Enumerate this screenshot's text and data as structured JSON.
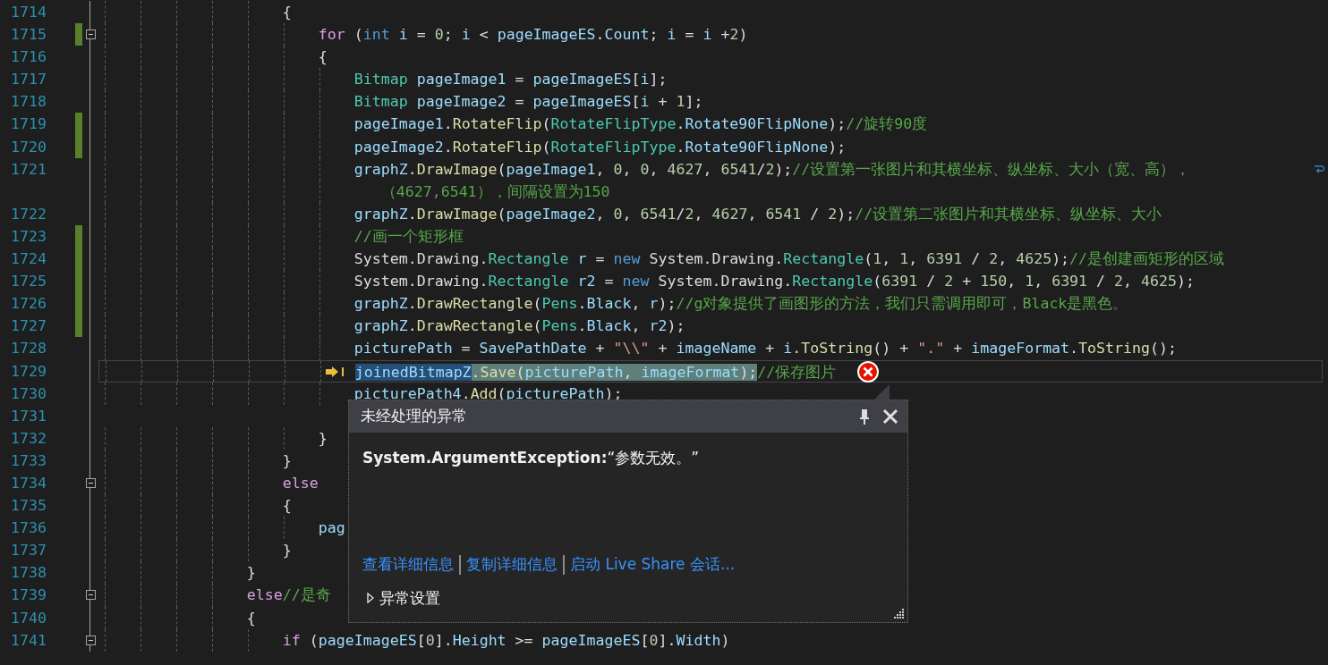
{
  "editor": {
    "lines": [
      {
        "number": "1714",
        "changed": false,
        "foldable": false,
        "tokens": [
          {
            "kind": "plain",
            "text": "                    {"
          }
        ]
      },
      {
        "number": "1715",
        "changed": true,
        "foldable": true,
        "tokens": [
          {
            "kind": "control",
            "text": "                        for"
          },
          {
            "kind": "plain",
            "text": " ("
          },
          {
            "kind": "keyword",
            "text": "int"
          },
          {
            "kind": "ident",
            "text": " i"
          },
          {
            "kind": "plain",
            "text": " = "
          },
          {
            "kind": "number",
            "text": "0"
          },
          {
            "kind": "plain",
            "text": "; "
          },
          {
            "kind": "ident",
            "text": "i"
          },
          {
            "kind": "plain",
            "text": " < "
          },
          {
            "kind": "ident",
            "text": "pageImageES"
          },
          {
            "kind": "plain",
            "text": "."
          },
          {
            "kind": "ident",
            "text": "Count"
          },
          {
            "kind": "plain",
            "text": "; "
          },
          {
            "kind": "ident",
            "text": "i"
          },
          {
            "kind": "plain",
            "text": " = "
          },
          {
            "kind": "ident",
            "text": "i"
          },
          {
            "kind": "plain",
            "text": " +"
          },
          {
            "kind": "number",
            "text": "2"
          },
          {
            "kind": "plain",
            "text": ")"
          }
        ]
      },
      {
        "number": "1716",
        "changed": false,
        "foldable": false,
        "tokens": [
          {
            "kind": "plain",
            "text": "                        {"
          }
        ]
      },
      {
        "number": "1717",
        "changed": false,
        "foldable": false,
        "tokens": [
          {
            "kind": "type",
            "text": "                            Bitmap"
          },
          {
            "kind": "ident",
            "text": " pageImage1"
          },
          {
            "kind": "plain",
            "text": " = "
          },
          {
            "kind": "ident",
            "text": "pageImageES"
          },
          {
            "kind": "plain",
            "text": "["
          },
          {
            "kind": "ident",
            "text": "i"
          },
          {
            "kind": "plain",
            "text": "];"
          }
        ]
      },
      {
        "number": "1718",
        "changed": false,
        "foldable": false,
        "tokens": [
          {
            "kind": "type",
            "text": "                            Bitmap"
          },
          {
            "kind": "ident",
            "text": " pageImage2"
          },
          {
            "kind": "plain",
            "text": " = "
          },
          {
            "kind": "ident",
            "text": "pageImageES"
          },
          {
            "kind": "plain",
            "text": "["
          },
          {
            "kind": "ident",
            "text": "i"
          },
          {
            "kind": "plain",
            "text": " + "
          },
          {
            "kind": "number",
            "text": "1"
          },
          {
            "kind": "plain",
            "text": "];"
          }
        ]
      },
      {
        "number": "1719",
        "changed": true,
        "foldable": false,
        "tokens": [
          {
            "kind": "ident",
            "text": "                            pageImage1"
          },
          {
            "kind": "plain",
            "text": "."
          },
          {
            "kind": "method",
            "text": "RotateFlip"
          },
          {
            "kind": "plain",
            "text": "("
          },
          {
            "kind": "type",
            "text": "RotateFlipType"
          },
          {
            "kind": "plain",
            "text": "."
          },
          {
            "kind": "ident",
            "text": "Rotate90FlipNone"
          },
          {
            "kind": "plain",
            "text": ");"
          },
          {
            "kind": "comment",
            "text": "//旋转90度"
          }
        ]
      },
      {
        "number": "1720",
        "changed": true,
        "foldable": false,
        "tokens": [
          {
            "kind": "ident",
            "text": "                            pageImage2"
          },
          {
            "kind": "plain",
            "text": "."
          },
          {
            "kind": "method",
            "text": "RotateFlip"
          },
          {
            "kind": "plain",
            "text": "("
          },
          {
            "kind": "type",
            "text": "RotateFlipType"
          },
          {
            "kind": "plain",
            "text": "."
          },
          {
            "kind": "ident",
            "text": "Rotate90FlipNone"
          },
          {
            "kind": "plain",
            "text": ");"
          }
        ]
      },
      {
        "number": "1721",
        "changed": false,
        "foldable": false,
        "tokens": [
          {
            "kind": "ident",
            "text": "                            graphZ"
          },
          {
            "kind": "plain",
            "text": "."
          },
          {
            "kind": "method",
            "text": "DrawImage"
          },
          {
            "kind": "plain",
            "text": "("
          },
          {
            "kind": "ident",
            "text": "pageImage1"
          },
          {
            "kind": "plain",
            "text": ", "
          },
          {
            "kind": "number",
            "text": "0"
          },
          {
            "kind": "plain",
            "text": ", "
          },
          {
            "kind": "number",
            "text": "0"
          },
          {
            "kind": "plain",
            "text": ", "
          },
          {
            "kind": "number",
            "text": "4627"
          },
          {
            "kind": "plain",
            "text": ", "
          },
          {
            "kind": "number",
            "text": "6541"
          },
          {
            "kind": "plain",
            "text": "/"
          },
          {
            "kind": "number",
            "text": "2"
          },
          {
            "kind": "plain",
            "text": ");"
          },
          {
            "kind": "comment",
            "text": "//设置第一张图片和其横坐标、纵坐标、大小（宽、高），"
          }
        ],
        "continuation": [
          {
            "kind": "comment",
            "text": "                               （4627,6541），间隔设置为150"
          }
        ]
      },
      {
        "number": "1722",
        "changed": false,
        "foldable": false,
        "tokens": [
          {
            "kind": "ident",
            "text": "                            graphZ"
          },
          {
            "kind": "plain",
            "text": "."
          },
          {
            "kind": "method",
            "text": "DrawImage"
          },
          {
            "kind": "plain",
            "text": "("
          },
          {
            "kind": "ident",
            "text": "pageImage2"
          },
          {
            "kind": "plain",
            "text": ", "
          },
          {
            "kind": "number",
            "text": "0"
          },
          {
            "kind": "plain",
            "text": ", "
          },
          {
            "kind": "number",
            "text": "6541"
          },
          {
            "kind": "plain",
            "text": "/"
          },
          {
            "kind": "number",
            "text": "2"
          },
          {
            "kind": "plain",
            "text": ", "
          },
          {
            "kind": "number",
            "text": "4627"
          },
          {
            "kind": "plain",
            "text": ", "
          },
          {
            "kind": "number",
            "text": "6541"
          },
          {
            "kind": "plain",
            "text": " / "
          },
          {
            "kind": "number",
            "text": "2"
          },
          {
            "kind": "plain",
            "text": ");"
          },
          {
            "kind": "comment",
            "text": "//设置第二张图片和其横坐标、纵坐标、大小"
          }
        ]
      },
      {
        "number": "1723",
        "changed": true,
        "foldable": false,
        "tokens": [
          {
            "kind": "comment",
            "text": "                            //画一个矩形框"
          }
        ]
      },
      {
        "number": "1724",
        "changed": true,
        "foldable": false,
        "tokens": [
          {
            "kind": "plain",
            "text": "                            System.Drawing."
          },
          {
            "kind": "type",
            "text": "Rectangle"
          },
          {
            "kind": "ident",
            "text": " r"
          },
          {
            "kind": "plain",
            "text": " = "
          },
          {
            "kind": "keyword",
            "text": "new"
          },
          {
            "kind": "plain",
            "text": " System.Drawing."
          },
          {
            "kind": "type",
            "text": "Rectangle"
          },
          {
            "kind": "plain",
            "text": "("
          },
          {
            "kind": "number",
            "text": "1"
          },
          {
            "kind": "plain",
            "text": ", "
          },
          {
            "kind": "number",
            "text": "1"
          },
          {
            "kind": "plain",
            "text": ", "
          },
          {
            "kind": "number",
            "text": "6391"
          },
          {
            "kind": "plain",
            "text": " / "
          },
          {
            "kind": "number",
            "text": "2"
          },
          {
            "kind": "plain",
            "text": ", "
          },
          {
            "kind": "number",
            "text": "4625"
          },
          {
            "kind": "plain",
            "text": ");"
          },
          {
            "kind": "comment",
            "text": "//是创建画矩形的区域"
          }
        ]
      },
      {
        "number": "1725",
        "changed": true,
        "foldable": false,
        "tokens": [
          {
            "kind": "plain",
            "text": "                            System.Drawing."
          },
          {
            "kind": "type",
            "text": "Rectangle"
          },
          {
            "kind": "ident",
            "text": " r2"
          },
          {
            "kind": "plain",
            "text": " = "
          },
          {
            "kind": "keyword",
            "text": "new"
          },
          {
            "kind": "plain",
            "text": " System.Drawing."
          },
          {
            "kind": "type",
            "text": "Rectangle"
          },
          {
            "kind": "plain",
            "text": "("
          },
          {
            "kind": "number",
            "text": "6391"
          },
          {
            "kind": "plain",
            "text": " / "
          },
          {
            "kind": "number",
            "text": "2"
          },
          {
            "kind": "plain",
            "text": " + "
          },
          {
            "kind": "number",
            "text": "150"
          },
          {
            "kind": "plain",
            "text": ", "
          },
          {
            "kind": "number",
            "text": "1"
          },
          {
            "kind": "plain",
            "text": ", "
          },
          {
            "kind": "number",
            "text": "6391"
          },
          {
            "kind": "plain",
            "text": " / "
          },
          {
            "kind": "number",
            "text": "2"
          },
          {
            "kind": "plain",
            "text": ", "
          },
          {
            "kind": "number",
            "text": "4625"
          },
          {
            "kind": "plain",
            "text": ");"
          }
        ]
      },
      {
        "number": "1726",
        "changed": true,
        "foldable": false,
        "tokens": [
          {
            "kind": "ident",
            "text": "                            graphZ"
          },
          {
            "kind": "plain",
            "text": "."
          },
          {
            "kind": "method",
            "text": "DrawRectangle"
          },
          {
            "kind": "plain",
            "text": "("
          },
          {
            "kind": "type",
            "text": "Pens"
          },
          {
            "kind": "plain",
            "text": "."
          },
          {
            "kind": "ident",
            "text": "Black"
          },
          {
            "kind": "plain",
            "text": ", "
          },
          {
            "kind": "ident",
            "text": "r"
          },
          {
            "kind": "plain",
            "text": ");"
          },
          {
            "kind": "comment",
            "text": "//g对象提供了画图形的方法，我们只需调用即可，Black是黑色。"
          }
        ]
      },
      {
        "number": "1727",
        "changed": true,
        "foldable": false,
        "tokens": [
          {
            "kind": "ident",
            "text": "                            graphZ"
          },
          {
            "kind": "plain",
            "text": "."
          },
          {
            "kind": "method",
            "text": "DrawRectangle"
          },
          {
            "kind": "plain",
            "text": "("
          },
          {
            "kind": "type",
            "text": "Pens"
          },
          {
            "kind": "plain",
            "text": "."
          },
          {
            "kind": "ident",
            "text": "Black"
          },
          {
            "kind": "plain",
            "text": ", "
          },
          {
            "kind": "ident",
            "text": "r2"
          },
          {
            "kind": "plain",
            "text": ");"
          }
        ]
      },
      {
        "number": "1728",
        "changed": false,
        "foldable": false,
        "tokens": [
          {
            "kind": "ident",
            "text": "                            picturePath"
          },
          {
            "kind": "plain",
            "text": " = "
          },
          {
            "kind": "ident",
            "text": "SavePathDate"
          },
          {
            "kind": "plain",
            "text": " + "
          },
          {
            "kind": "string",
            "text": "\"\\\\\""
          },
          {
            "kind": "plain",
            "text": " + "
          },
          {
            "kind": "ident",
            "text": "imageName"
          },
          {
            "kind": "plain",
            "text": " + "
          },
          {
            "kind": "ident",
            "text": "i"
          },
          {
            "kind": "plain",
            "text": "."
          },
          {
            "kind": "method",
            "text": "ToString"
          },
          {
            "kind": "plain",
            "text": "() + "
          },
          {
            "kind": "string",
            "text": "\".\""
          },
          {
            "kind": "plain",
            "text": " + "
          },
          {
            "kind": "ident",
            "text": "imageFormat"
          },
          {
            "kind": "plain",
            "text": "."
          },
          {
            "kind": "method",
            "text": "ToString"
          },
          {
            "kind": "plain",
            "text": "();"
          }
        ]
      },
      {
        "number": "1729",
        "changed": false,
        "foldable": false,
        "current": true,
        "error": true,
        "tokens": [
          {
            "kind": "ident",
            "text": "                            joinedBitmapZ",
            "selected": true,
            "executing": true
          },
          {
            "kind": "plain",
            "text": ".",
            "selected": false,
            "executing": true
          },
          {
            "kind": "method",
            "text": "Save",
            "selected": false,
            "executing": true
          },
          {
            "kind": "plain",
            "text": "(",
            "selected": false,
            "executing": true
          },
          {
            "kind": "ident",
            "text": "picturePath",
            "selected": false,
            "executing": true
          },
          {
            "kind": "plain",
            "text": ", ",
            "selected": false,
            "executing": true
          },
          {
            "kind": "ident",
            "text": "imageFormat",
            "selected": false,
            "executing": true
          },
          {
            "kind": "plain",
            "text": ");",
            "selected": false,
            "executing": true
          },
          {
            "kind": "comment",
            "text": "//保存图片",
            "selected": false,
            "executing": false
          }
        ]
      },
      {
        "number": "1730",
        "changed": false,
        "foldable": false,
        "tokens": [
          {
            "kind": "ident",
            "text": "                            picturePath4"
          },
          {
            "kind": "plain",
            "text": "."
          },
          {
            "kind": "method",
            "text": "Add"
          },
          {
            "kind": "plain",
            "text": "("
          },
          {
            "kind": "ident",
            "text": "picturePath"
          },
          {
            "kind": "plain",
            "text": ");"
          }
        ]
      },
      {
        "number": "1731",
        "changed": false,
        "foldable": false
      },
      {
        "number": "1732",
        "changed": false,
        "foldable": false,
        "tokens": [
          {
            "kind": "plain",
            "text": "                        }"
          }
        ]
      },
      {
        "number": "1733",
        "changed": false,
        "foldable": false,
        "tokens": [
          {
            "kind": "plain",
            "text": "                    }"
          }
        ]
      },
      {
        "number": "1734",
        "changed": false,
        "foldable": true,
        "tokens": [
          {
            "kind": "control",
            "text": "                    else"
          }
        ]
      },
      {
        "number": "1735",
        "changed": false,
        "foldable": false,
        "tokens": [
          {
            "kind": "plain",
            "text": "                    {"
          }
        ]
      },
      {
        "number": "1736",
        "changed": false,
        "foldable": false,
        "tokens": [
          {
            "kind": "ident",
            "text": "                        pag"
          }
        ]
      },
      {
        "number": "1737",
        "changed": false,
        "foldable": false,
        "tokens": [
          {
            "kind": "plain",
            "text": "                    }"
          }
        ]
      },
      {
        "number": "1738",
        "changed": false,
        "foldable": false,
        "tokens": [
          {
            "kind": "plain",
            "text": "                }"
          }
        ]
      },
      {
        "number": "1739",
        "changed": false,
        "foldable": true,
        "tokens": [
          {
            "kind": "control",
            "text": "                else"
          },
          {
            "kind": "comment",
            "text": "//是奇"
          }
        ]
      },
      {
        "number": "1740",
        "changed": false,
        "foldable": false,
        "tokens": [
          {
            "kind": "plain",
            "text": "                {"
          }
        ]
      },
      {
        "number": "1741",
        "changed": false,
        "foldable": true,
        "tokens": [
          {
            "kind": "control",
            "text": "                    if"
          },
          {
            "kind": "plain",
            "text": " ("
          },
          {
            "kind": "ident",
            "text": "pageImageES"
          },
          {
            "kind": "plain",
            "text": "["
          },
          {
            "kind": "number",
            "text": "0"
          },
          {
            "kind": "plain",
            "text": "]."
          },
          {
            "kind": "ident",
            "text": "Height"
          },
          {
            "kind": "plain",
            "text": " >= "
          },
          {
            "kind": "ident",
            "text": "pageImageES"
          },
          {
            "kind": "plain",
            "text": "["
          },
          {
            "kind": "number",
            "text": "0"
          },
          {
            "kind": "plain",
            "text": "]."
          },
          {
            "kind": "ident",
            "text": "Width"
          },
          {
            "kind": "plain",
            "text": ")"
          }
        ]
      }
    ]
  },
  "exception_popup": {
    "title": "未经处理的异常",
    "message": "**System.ArgumentException:**“参数无效。”",
    "links": [
      "查看详细信息",
      "复制详细信息",
      "启动 Live Share 会话..."
    ],
    "settings": {
      "label": "异常设置",
      "expanded": false
    }
  }
}
